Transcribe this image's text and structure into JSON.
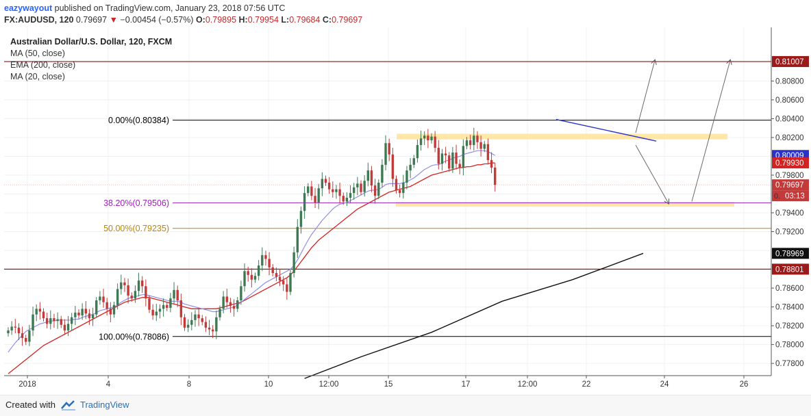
{
  "header": {
    "user": "eazywayout",
    "published_text": "published on TradingView.com, January 23, 2018 07:56 UTC",
    "symbol": "FX:AUDUSD, 120",
    "last": "0.79697",
    "change": "−0.00454 (−0.57%)",
    "open_label": "O:",
    "open": "0.79895",
    "high_label": "H:",
    "high": "0.79954",
    "low_label": "L:",
    "low": "0.79684",
    "close_label": "C:",
    "close": "0.79697"
  },
  "legend": {
    "title": "Australian Dollar/U.S. Dollar, 120, FXCM",
    "ma50": "MA (50, close)",
    "ema200": "EMA (200, close)",
    "ma20": "MA (20, close)"
  },
  "footer": {
    "created_with": "Created with",
    "brand": "TradingView"
  },
  "colors": {
    "up": "#3d7a53",
    "down": "#c23a3a",
    "ma20": "#8e8ee8",
    "ma50": "#d32222",
    "ema200": "#111111",
    "fib_0": "#000000",
    "fib_382": "#a020c0",
    "fib_50": "#b8860b",
    "fib_100": "#000000",
    "level_red": "#9b1b1b",
    "zone": "#ffe08a",
    "trendline": "#2a32c8"
  },
  "chart_data": {
    "type": "candlestick",
    "title": "Australian Dollar/U.S. Dollar, 120, FXCM",
    "x_tick_labels": [
      "2018",
      "4",
      "8",
      "10",
      "12:00",
      "15",
      "17",
      "12:00",
      "22",
      "24",
      "26"
    ],
    "y_ticks": [
      "0.80800",
      "0.80600",
      "0.80400",
      "0.80200",
      "0.79800",
      "0.79400",
      "0.79200",
      "0.78600",
      "0.78400",
      "0.78200",
      "0.78000",
      "0.77800"
    ],
    "y_range": [
      0.7767,
      0.8137
    ],
    "price_labels": [
      {
        "text": "0.81007",
        "value": 0.81007,
        "color": "#9b1b1b"
      },
      {
        "text": "0.80009",
        "value": 0.80009,
        "color": "#2a32c8"
      },
      {
        "text": "0.79930",
        "value": 0.7993,
        "color": "#d32222"
      },
      {
        "text": "0.79697",
        "value": 0.79697,
        "color": "#c23a3a"
      },
      {
        "text": "0.78969",
        "value": 0.78969,
        "color": "#111111"
      },
      {
        "text": "0.78801",
        "value": 0.78801,
        "color": "#9b1b1b"
      }
    ],
    "countdown": "03:13",
    "countdown_partial": "0.",
    "fib_levels": [
      {
        "label": "0.00%(0.80384)",
        "value": 0.80384
      },
      {
        "label": "38.20%(0.79506)",
        "value": 0.79506
      },
      {
        "label": "50.00%(0.79235)",
        "value": 0.79235
      },
      {
        "label": "100.00%(0.78086)",
        "value": 0.78086
      }
    ],
    "horizontal_levels": [
      0.81007,
      0.78801
    ],
    "zones": [
      {
        "from": 0.8018,
        "to": 0.8024
      },
      {
        "from": 0.79465,
        "to": 0.79515
      }
    ],
    "closes": [
      0.7815,
      0.7819,
      0.7818,
      0.7812,
      0.7807,
      0.7803,
      0.7815,
      0.7832,
      0.7838,
      0.7835,
      0.7828,
      0.7822,
      0.7828,
      0.7825,
      0.7827,
      0.7821,
      0.7815,
      0.7822,
      0.7829,
      0.7834,
      0.7831,
      0.7838,
      0.7833,
      0.7828,
      0.7832,
      0.7847,
      0.7851,
      0.7845,
      0.7838,
      0.7832,
      0.7842,
      0.7859,
      0.7866,
      0.7863,
      0.7852,
      0.7849,
      0.7857,
      0.7868,
      0.7862,
      0.7849,
      0.7837,
      0.7831,
      0.7835,
      0.7838,
      0.7842,
      0.7839,
      0.7849,
      0.7858,
      0.7847,
      0.7829,
      0.7818,
      0.7821,
      0.7826,
      0.7832,
      0.7828,
      0.7824,
      0.7818,
      0.7816,
      0.7814,
      0.7829,
      0.7838,
      0.7851,
      0.7845,
      0.7841,
      0.7838,
      0.7847,
      0.7862,
      0.7878,
      0.7874,
      0.7869,
      0.7873,
      0.7884,
      0.7895,
      0.7891,
      0.7882,
      0.7876,
      0.7872,
      0.7868,
      0.7864,
      0.7856,
      0.7876,
      0.7898,
      0.7925,
      0.7942,
      0.7961,
      0.7968,
      0.7958,
      0.7951,
      0.7966,
      0.7976,
      0.7972,
      0.7965,
      0.7962,
      0.7965,
      0.7958,
      0.7952,
      0.7956,
      0.7961,
      0.7967,
      0.7971,
      0.7962,
      0.7974,
      0.7985,
      0.7969,
      0.7958,
      0.7972,
      0.7991,
      0.8014,
      0.8002,
      0.7976,
      0.7964,
      0.7961,
      0.7972,
      0.7985,
      0.7991,
      0.7998,
      0.8012,
      0.8019,
      0.8022,
      0.8017,
      0.8021,
      0.8009,
      0.7992,
      0.8003,
      0.8001,
      0.7987,
      0.8004,
      0.7992,
      0.7988,
      0.8011,
      0.8017,
      0.8012,
      0.8022,
      0.8015,
      0.8008,
      0.8013,
      0.7996,
      0.7988,
      0.79697
    ],
    "ma20": [
      0.7792,
      0.7797,
      0.7802,
      0.7806,
      0.781,
      0.7814,
      0.7816,
      0.7818,
      0.782,
      0.7822,
      0.7823,
      0.7824,
      0.7825,
      0.7825,
      0.7826,
      0.7826,
      0.7826,
      0.7826,
      0.7826,
      0.7827,
      0.7827,
      0.7829,
      0.783,
      0.7831,
      0.7832,
      0.7834,
      0.7836,
      0.7837,
      0.7838,
      0.7839,
      0.784,
      0.7842,
      0.7845,
      0.7847,
      0.7849,
      0.785,
      0.7851,
      0.7852,
      0.7853,
      0.7853,
      0.7852,
      0.7851,
      0.785,
      0.7849,
      0.7848,
      0.7847,
      0.7846,
      0.7846,
      0.7846,
      0.7845,
      0.7843,
      0.7842,
      0.7841,
      0.784,
      0.7839,
      0.7838,
      0.7837,
      0.7836,
      0.7835,
      0.7835,
      0.7836,
      0.7837,
      0.7838,
      0.7839,
      0.784,
      0.7842,
      0.7845,
      0.7848,
      0.7851,
      0.7854,
      0.7857,
      0.786,
      0.7863,
      0.7866,
      0.7868,
      0.787,
      0.7872,
      0.7874,
      0.7876,
      0.7878,
      0.788,
      0.7884,
      0.789,
      0.7897,
      0.7904,
      0.7911,
      0.7917,
      0.7922,
      0.7927,
      0.7932,
      0.7936,
      0.794,
      0.7944,
      0.7947,
      0.7949,
      0.795,
      0.7951,
      0.7953,
      0.7955,
      0.7957,
      0.7959,
      0.7961,
      0.7963,
      0.7964,
      0.7964,
      0.7965,
      0.7967,
      0.797,
      0.7971,
      0.7971,
      0.7971,
      0.7971,
      0.7972,
      0.7973,
      0.7975,
      0.7977,
      0.798,
      0.7983,
      0.7986,
      0.7988,
      0.799,
      0.7991,
      0.7991,
      0.7993,
      0.7995,
      0.7996,
      0.7998,
      0.7999,
      0.8,
      0.8002,
      0.8003,
      0.8004,
      0.8005,
      0.8006,
      0.8006,
      0.8006,
      0.8005,
      0.8003,
      0.8001
    ],
    "ma50": [
      0.7769,
      0.7772,
      0.7775,
      0.7778,
      0.7781,
      0.7784,
      0.7787,
      0.779,
      0.7793,
      0.7796,
      0.7799,
      0.7801,
      0.7803,
      0.7805,
      0.7807,
      0.7809,
      0.7811,
      0.7813,
      0.7815,
      0.7817,
      0.7819,
      0.7821,
      0.7823,
      0.7825,
      0.7827,
      0.7829,
      0.7831,
      0.7833,
      0.7835,
      0.7837,
      0.7839,
      0.7841,
      0.7843,
      0.7845,
      0.7846,
      0.7847,
      0.7848,
      0.7849,
      0.785,
      0.785,
      0.785,
      0.7849,
      0.7848,
      0.7847,
      0.7846,
      0.7845,
      0.7844,
      0.7843,
      0.7842,
      0.7841,
      0.784,
      0.7839,
      0.7838,
      0.7838,
      0.7838,
      0.7838,
      0.7838,
      0.7838,
      0.7838,
      0.7838,
      0.7839,
      0.784,
      0.7841,
      0.7842,
      0.7843,
      0.7844,
      0.7845,
      0.7847,
      0.7849,
      0.7851,
      0.7853,
      0.7855,
      0.7857,
      0.7859,
      0.7861,
      0.7863,
      0.7865,
      0.7867,
      0.7869,
      0.7871,
      0.7874,
      0.7878,
      0.7883,
      0.7888,
      0.7893,
      0.7898,
      0.7903,
      0.7907,
      0.7911,
      0.7914,
      0.7917,
      0.792,
      0.7923,
      0.7926,
      0.7929,
      0.7932,
      0.7935,
      0.7938,
      0.7941,
      0.7944,
      0.7946,
      0.7948,
      0.795,
      0.7952,
      0.7954,
      0.7956,
      0.7958,
      0.796,
      0.7962,
      0.7963,
      0.7964,
      0.7965,
      0.7966,
      0.7967,
      0.7968,
      0.797,
      0.7972,
      0.7974,
      0.7976,
      0.7978,
      0.798,
      0.7981,
      0.7982,
      0.7983,
      0.7984,
      0.7985,
      0.7986,
      0.7987,
      0.7988,
      0.7988,
      0.7989,
      0.7989,
      0.799,
      0.7991,
      0.7991,
      0.7992,
      0.7992,
      0.7993,
      0.7993
    ],
    "ema200_points": [
      {
        "i": 84,
        "v": 0.7764
      },
      {
        "i": 100,
        "v": 0.7787
      },
      {
        "i": 120,
        "v": 0.7813
      },
      {
        "i": 140,
        "v": 0.7846
      },
      {
        "i": 160,
        "v": 0.7869
      },
      {
        "i": 180,
        "v": 0.78969
      }
    ]
  }
}
